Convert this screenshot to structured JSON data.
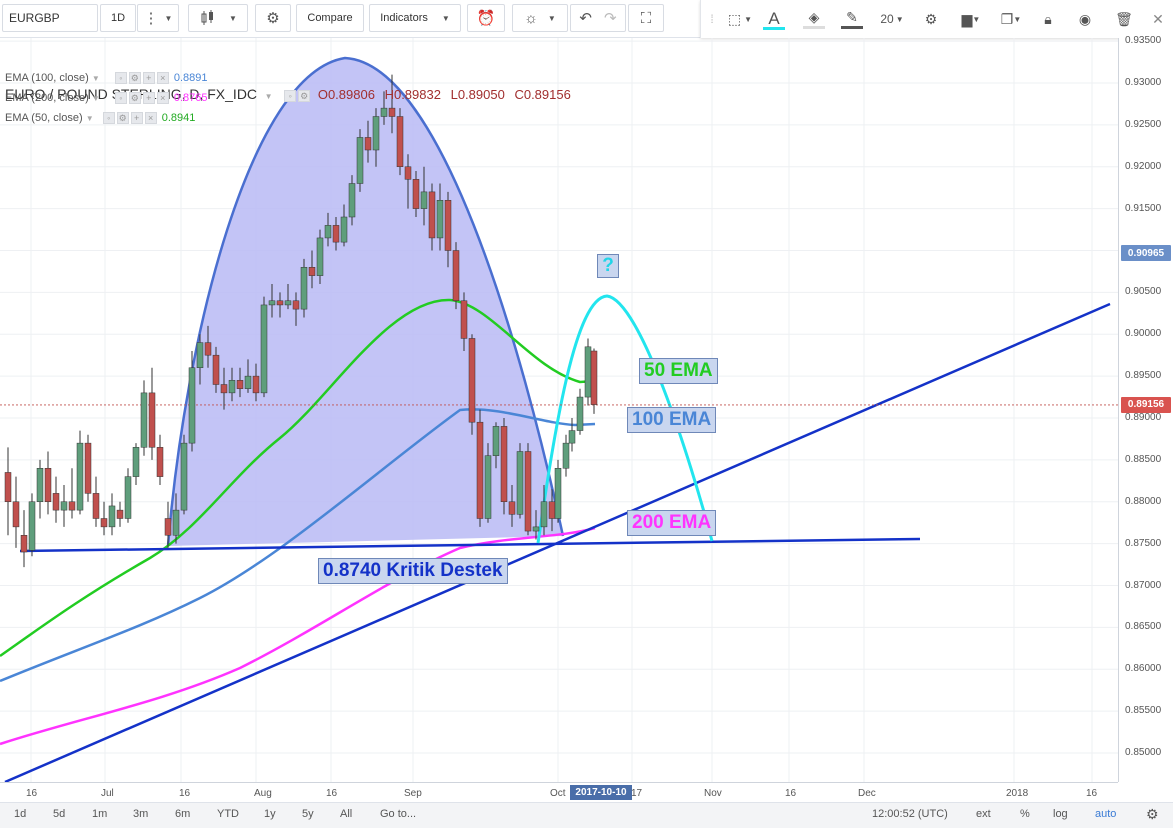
{
  "toolbar": {
    "symbol": "EURGBP",
    "interval": "1D",
    "compare_label": "Compare",
    "indicators_label": "Indicators",
    "font_size_value": "20"
  },
  "legend": {
    "title": "EURO / POUND STERLING, D, FX_IDC",
    "open": "O0.89806",
    "high": "H0.89832",
    "low": "L0.89050",
    "close": "C0.89156",
    "ema100_label": "EMA (100, close)",
    "ema100_value": "0.8891",
    "ema200_label": "EMA (200, close)",
    "ema200_value": "0.8765",
    "ema50_label": "EMA (50, close)",
    "ema50_value": "0.8941"
  },
  "annotations": {
    "question": "?",
    "ema50": "50 EMA",
    "ema100": "100 EMA",
    "ema200": "200 EMA",
    "support": "0.8740 Kritik Destek"
  },
  "yaxis": {
    "ticks": [
      "0.93500",
      "0.93000",
      "0.92500",
      "0.92000",
      "0.91500",
      "0.91000",
      "0.90500",
      "0.90000",
      "0.89500",
      "0.89000",
      "0.88500",
      "0.88000",
      "0.87500",
      "0.87000",
      "0.86500",
      "0.86000",
      "0.85500",
      "0.85000"
    ],
    "price_tag_top": "0.90965",
    "price_tag_last": "0.89156"
  },
  "xaxis": {
    "ticks": [
      "16",
      "Jul",
      "16",
      "Aug",
      "16",
      "Sep",
      "Oct",
      "17",
      "Nov",
      "16",
      "Dec",
      "2018",
      "16"
    ],
    "cursor_date": "2017-10-10"
  },
  "bottombar": {
    "ranges": [
      "1d",
      "5d",
      "1m",
      "3m",
      "6m",
      "YTD",
      "1y",
      "5y",
      "All"
    ],
    "goto_label": "Go to...",
    "time": "12:00:52 (UTC)",
    "ext": "ext",
    "pct": "%",
    "log": "log",
    "auto": "auto"
  },
  "colors": {
    "ema50": "#22cc22",
    "ema100": "#4a86d6",
    "ema200": "#ff33ff",
    "trend": "#1432c8",
    "arc_fill": "#b8baf5",
    "arc_stroke": "#4a6fd0",
    "cyan": "#22e5ee",
    "up": "#5f9e7c",
    "down": "#c0504d"
  },
  "chart_data": {
    "type": "candlestick",
    "symbol": "EURGBP",
    "ylim": [
      0.846,
      0.935
    ],
    "series": [
      {
        "name": "EMA (100, close)",
        "last": 0.8891
      },
      {
        "name": "EMA (200, close)",
        "last": 0.8765
      },
      {
        "name": "EMA (50, close)",
        "last": 0.8941
      }
    ],
    "last_close": 0.89156
  }
}
